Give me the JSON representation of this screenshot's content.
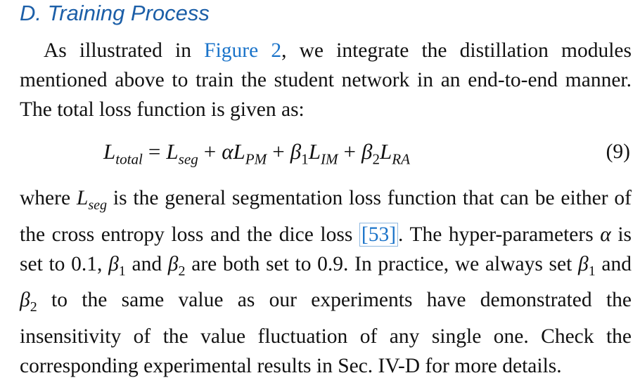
{
  "section": {
    "heading": "D. Training Process"
  },
  "paragraph1": {
    "pre": "As illustrated in ",
    "link": "Figure 2",
    "post": ", we integrate the distillation modules mentioned above to train the student network in an end-to-end manner. The total loss function is given as:"
  },
  "equation": {
    "L": "L",
    "total": "total",
    "eq": "=",
    "seg": "seg",
    "plus": "+",
    "alpha": "α",
    "PM": "PM",
    "beta": "β",
    "one": "1",
    "two": "2",
    "IM": "IM",
    "RA": "RA",
    "number": "(9)"
  },
  "paragraph2": {
    "t1": "where ",
    "t2": " is the general segmentation loss function that can be either of the cross entropy loss and the dice loss ",
    "cite": "[53]",
    "t3": ". The hyper-parameters ",
    "t4": " is set to 0.1, ",
    "t5": " and ",
    "t6": " are both set to 0.9. In practice, we always set ",
    "t7": " and ",
    "t8": " to the same value as our experiments have demonstrated the insensitivity of the value fluctuation of any single one. Check the corresponding experimental results in Sec. IV-D for more details."
  }
}
